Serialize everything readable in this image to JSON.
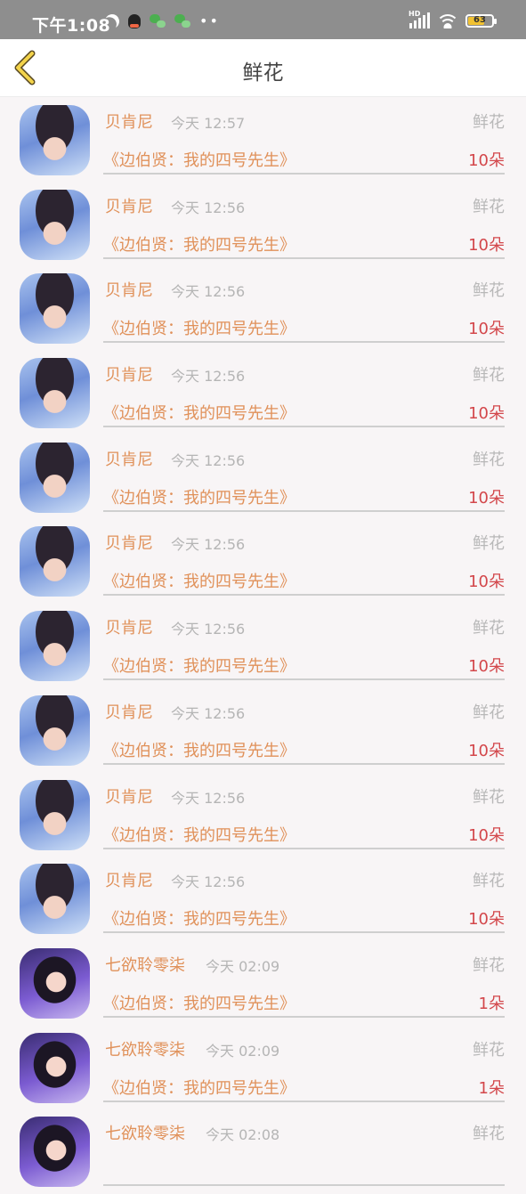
{
  "status_bar": {
    "time": "下午1:08",
    "network": "HD",
    "battery": "63"
  },
  "nav": {
    "title": "鲜花"
  },
  "records": [
    {
      "user": "贝肯尼",
      "time": "今天 12:57",
      "type": "鲜花",
      "book": "《边伯贤：我的四号先生》",
      "count": "10朵",
      "avatar": "a"
    },
    {
      "user": "贝肯尼",
      "time": "今天 12:56",
      "type": "鲜花",
      "book": "《边伯贤：我的四号先生》",
      "count": "10朵",
      "avatar": "a"
    },
    {
      "user": "贝肯尼",
      "time": "今天 12:56",
      "type": "鲜花",
      "book": "《边伯贤：我的四号先生》",
      "count": "10朵",
      "avatar": "a"
    },
    {
      "user": "贝肯尼",
      "time": "今天 12:56",
      "type": "鲜花",
      "book": "《边伯贤：我的四号先生》",
      "count": "10朵",
      "avatar": "a"
    },
    {
      "user": "贝肯尼",
      "time": "今天 12:56",
      "type": "鲜花",
      "book": "《边伯贤：我的四号先生》",
      "count": "10朵",
      "avatar": "a"
    },
    {
      "user": "贝肯尼",
      "time": "今天 12:56",
      "type": "鲜花",
      "book": "《边伯贤：我的四号先生》",
      "count": "10朵",
      "avatar": "a"
    },
    {
      "user": "贝肯尼",
      "time": "今天 12:56",
      "type": "鲜花",
      "book": "《边伯贤：我的四号先生》",
      "count": "10朵",
      "avatar": "a"
    },
    {
      "user": "贝肯尼",
      "time": "今天 12:56",
      "type": "鲜花",
      "book": "《边伯贤：我的四号先生》",
      "count": "10朵",
      "avatar": "a"
    },
    {
      "user": "贝肯尼",
      "time": "今天 12:56",
      "type": "鲜花",
      "book": "《边伯贤：我的四号先生》",
      "count": "10朵",
      "avatar": "a"
    },
    {
      "user": "贝肯尼",
      "time": "今天 12:56",
      "type": "鲜花",
      "book": "《边伯贤：我的四号先生》",
      "count": "10朵",
      "avatar": "a"
    },
    {
      "user": "七欲聆零柒",
      "time": "今天 02:09",
      "type": "鲜花",
      "book": "《边伯贤：我的四号先生》",
      "count": "1朵",
      "avatar": "b"
    },
    {
      "user": "七欲聆零柒",
      "time": "今天 02:09",
      "type": "鲜花",
      "book": "《边伯贤：我的四号先生》",
      "count": "1朵",
      "avatar": "b"
    },
    {
      "user": "七欲聆零柒",
      "time": "今天 02:08",
      "type": "鲜花",
      "book": "",
      "count": "",
      "avatar": "b"
    }
  ]
}
